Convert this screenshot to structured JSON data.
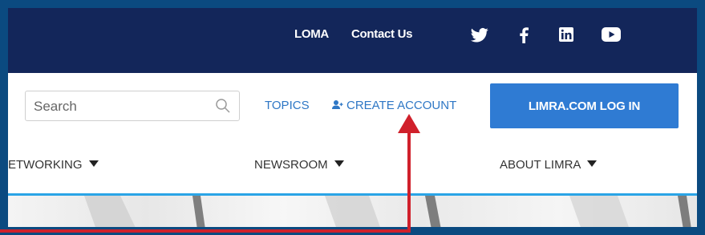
{
  "topbar": {
    "links": [
      "LOMA",
      "Contact Us"
    ],
    "social": [
      "twitter-icon",
      "facebook-icon",
      "linkedin-icon",
      "youtube-icon"
    ],
    "background_color": "#13265a"
  },
  "search": {
    "placeholder": "Search"
  },
  "nav": {
    "topics_label": "TOPICS",
    "create_account_label": "CREATE ACCOUNT",
    "login_label": "LIMRA.COM LOG IN"
  },
  "menu": {
    "items": [
      {
        "label": "ETWORKING"
      },
      {
        "label": "NEWSROOM"
      },
      {
        "label": "ABOUT LIMRA"
      }
    ]
  },
  "colors": {
    "accent_blue": "#2f7bd3",
    "link_blue": "#2e77c5",
    "frame_blue": "#0b4a80",
    "annotation_red": "#d0202b",
    "hero_border": "#2aa4e6"
  }
}
